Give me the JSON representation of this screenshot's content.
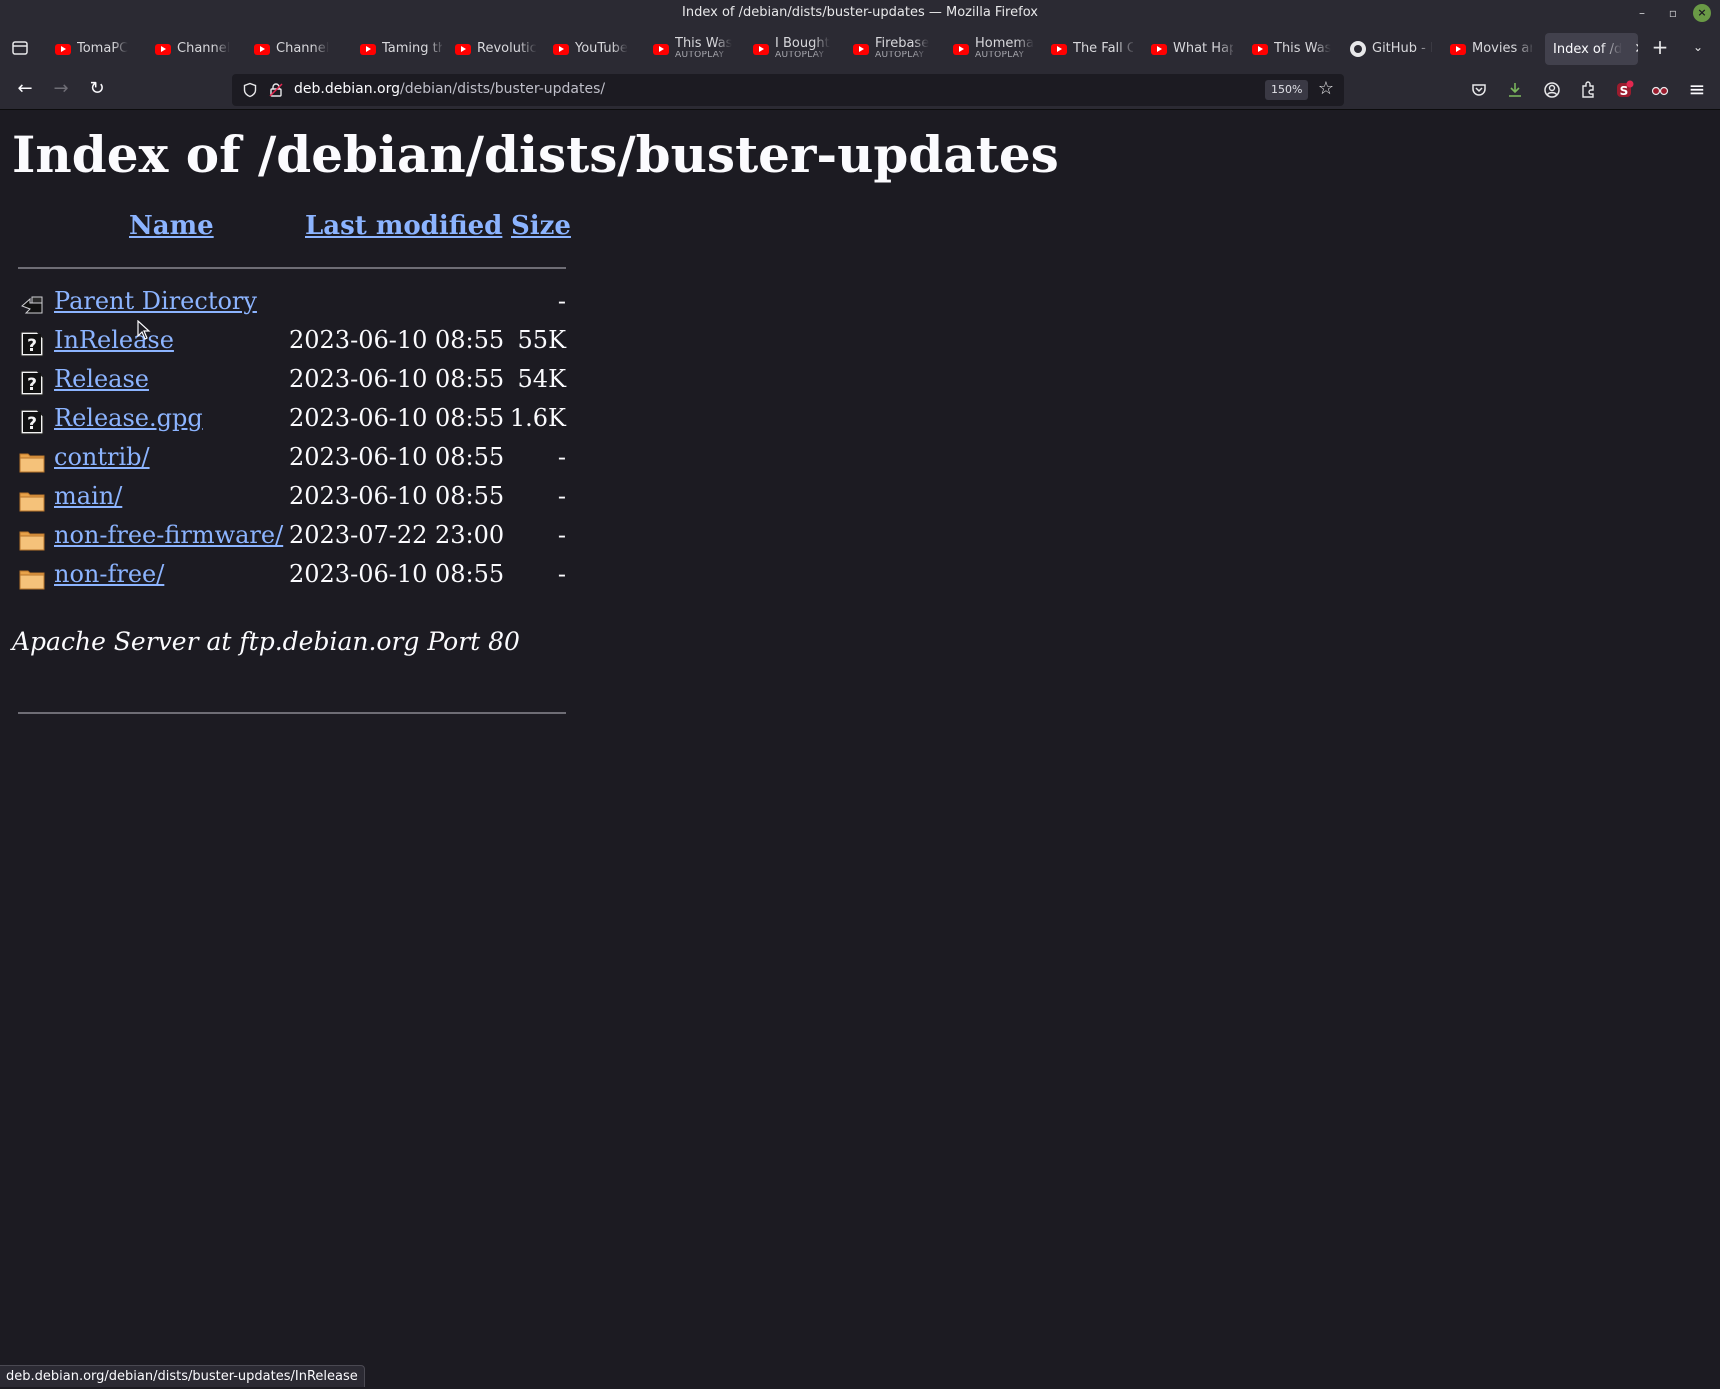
{
  "window": {
    "title": "Index of /debian/dists/buster-updates — Mozilla Firefox"
  },
  "tabs": [
    {
      "label": "TomaPC",
      "sub": "",
      "icon": "youtube-icon"
    },
    {
      "label": "Channel",
      "sub": "",
      "icon": "youtube-icon"
    },
    {
      "label": "Channel",
      "sub": "",
      "icon": "youtube-icon"
    },
    {
      "label": "Taming th",
      "sub": "",
      "icon": "youtube-icon"
    },
    {
      "label": "Revolutic",
      "sub": "",
      "icon": "youtube-icon"
    },
    {
      "label": "YouTube",
      "sub": "",
      "icon": "youtube-icon"
    },
    {
      "label": "This Was",
      "sub": "AUTOPLAY",
      "icon": "youtube-icon"
    },
    {
      "label": "I Bought",
      "sub": "AUTOPLAY",
      "icon": "youtube-icon"
    },
    {
      "label": "Firebase",
      "sub": "AUTOPLAY",
      "icon": "youtube-icon"
    },
    {
      "label": "Homema",
      "sub": "AUTOPLAY",
      "icon": "youtube-icon"
    },
    {
      "label": "The Fall C",
      "sub": "",
      "icon": "youtube-icon"
    },
    {
      "label": "What Hap",
      "sub": "",
      "icon": "youtube-icon"
    },
    {
      "label": "This Was",
      "sub": "",
      "icon": "youtube-icon"
    },
    {
      "label": "GitHub - I",
      "sub": "",
      "icon": "github-icon"
    },
    {
      "label": "Movies ar",
      "sub": "",
      "icon": "youtube-icon"
    }
  ],
  "active_tab": {
    "label": "Index of /d"
  },
  "navbar": {
    "url_host": "deb.debian.org",
    "url_path": "/debian/dists/buster-updates/",
    "zoom": "150%"
  },
  "page": {
    "heading": "Index of /debian/dists/buster-updates",
    "columns": {
      "name": "Name",
      "modified": "Last modified",
      "size": "Size"
    },
    "rows": [
      {
        "name": "Parent Directory",
        "modified": "",
        "size": "-",
        "icon": "back-icon"
      },
      {
        "name": "InRelease",
        "modified": "2023-06-10 08:55",
        "size": "55K",
        "icon": "unknown-file-icon"
      },
      {
        "name": "Release",
        "modified": "2023-06-10 08:55",
        "size": "54K",
        "icon": "unknown-file-icon"
      },
      {
        "name": "Release.gpg",
        "modified": "2023-06-10 08:55",
        "size": "1.6K",
        "icon": "unknown-file-icon"
      },
      {
        "name": "contrib/",
        "modified": "2023-06-10 08:55",
        "size": "-",
        "icon": "folder-icon"
      },
      {
        "name": "main/",
        "modified": "2023-06-10 08:55",
        "size": "-",
        "icon": "folder-icon"
      },
      {
        "name": "non-free-firmware/",
        "modified": "2023-07-22 23:00",
        "size": "-",
        "icon": "folder-icon"
      },
      {
        "name": "non-free/",
        "modified": "2023-06-10 08:55",
        "size": "-",
        "icon": "folder-icon"
      }
    ],
    "address": "Apache Server at ftp.debian.org Port 80"
  },
  "statusbar": {
    "text": "deb.debian.org/debian/dists/buster-updates/InRelease"
  },
  "colors": {
    "page_bg": "#1c1b22",
    "chrome_bg": "#2b2a33",
    "link": "#8cb4ff"
  }
}
